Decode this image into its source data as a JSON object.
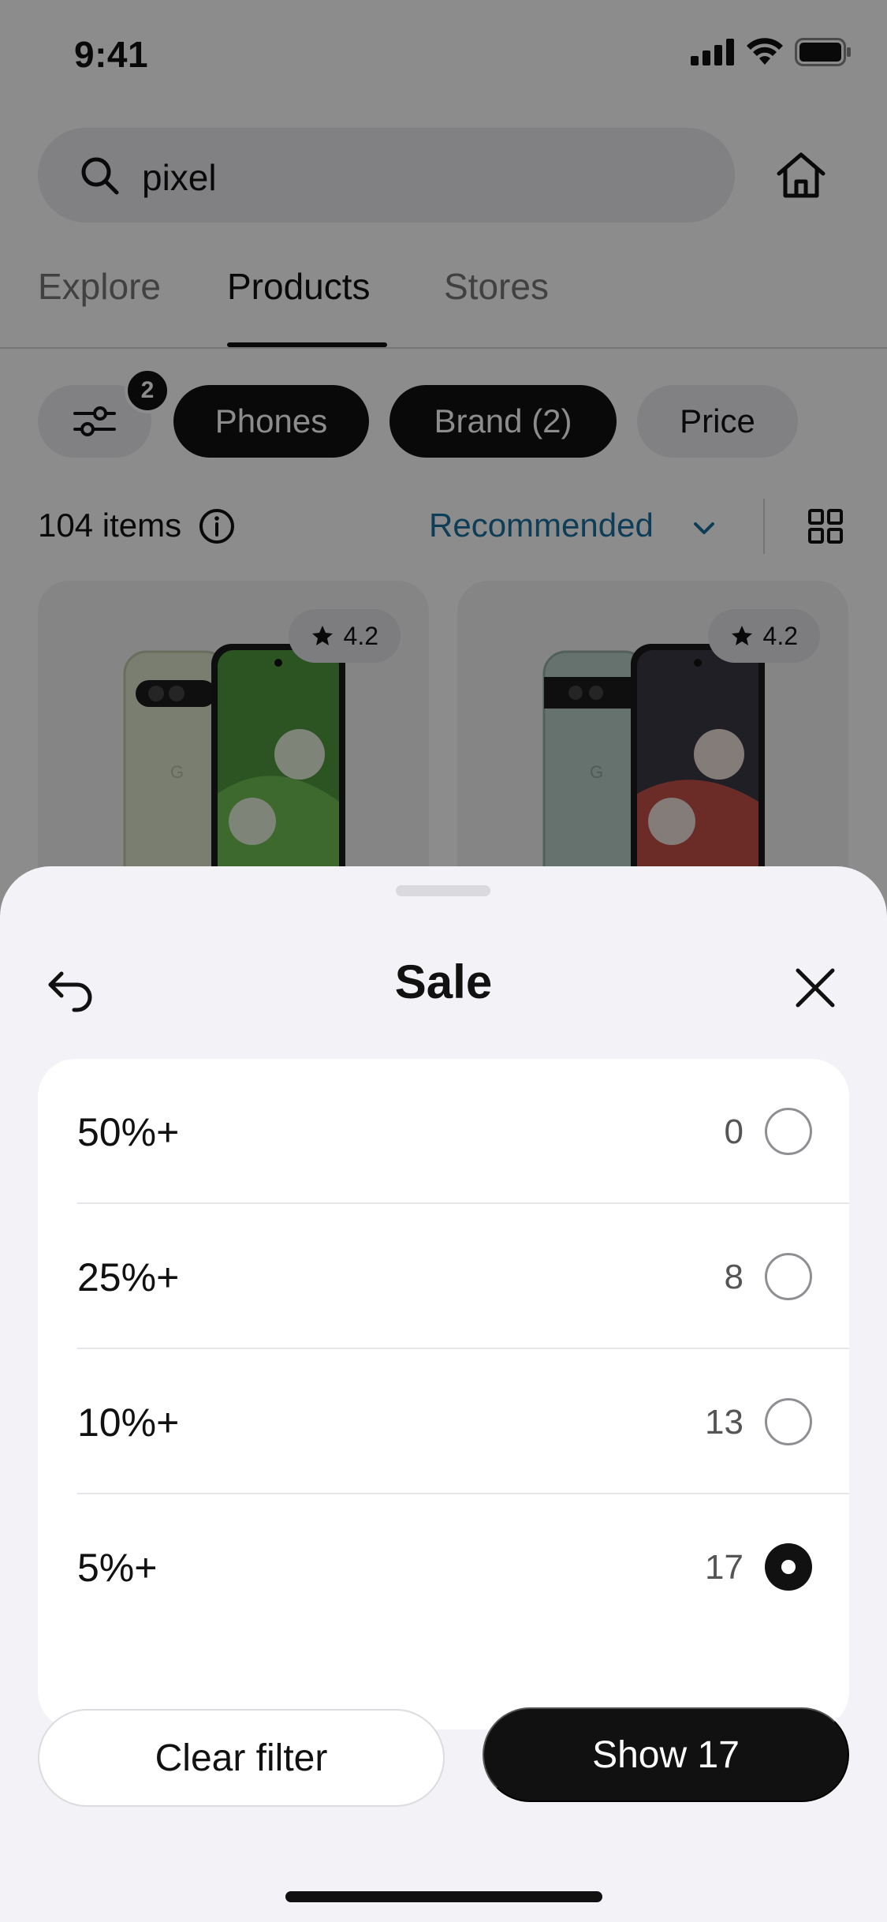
{
  "status_bar": {
    "time": "9:41"
  },
  "search": {
    "query": "pixel"
  },
  "tabs": [
    {
      "label": "Explore",
      "active": false
    },
    {
      "label": "Products",
      "active": true
    },
    {
      "label": "Stores",
      "active": false
    }
  ],
  "filters": {
    "badge_count": "2",
    "chips": [
      {
        "label": "Phones",
        "selected": true
      },
      {
        "label": "Brand (2)",
        "selected": true
      },
      {
        "label": "Price",
        "selected": false
      }
    ]
  },
  "results": {
    "count_label": "104 items",
    "sort_label": "Recommended"
  },
  "products": [
    {
      "rating": "4.2"
    },
    {
      "rating": "4.2"
    }
  ],
  "sheet": {
    "title": "Sale",
    "options": [
      {
        "label": "50%+",
        "count": "0",
        "selected": false
      },
      {
        "label": "25%+",
        "count": "8",
        "selected": false
      },
      {
        "label": "10%+",
        "count": "13",
        "selected": false
      },
      {
        "label": "5%+",
        "count": "17",
        "selected": true
      }
    ],
    "clear_label": "Clear filter",
    "show_label": "Show 17"
  }
}
